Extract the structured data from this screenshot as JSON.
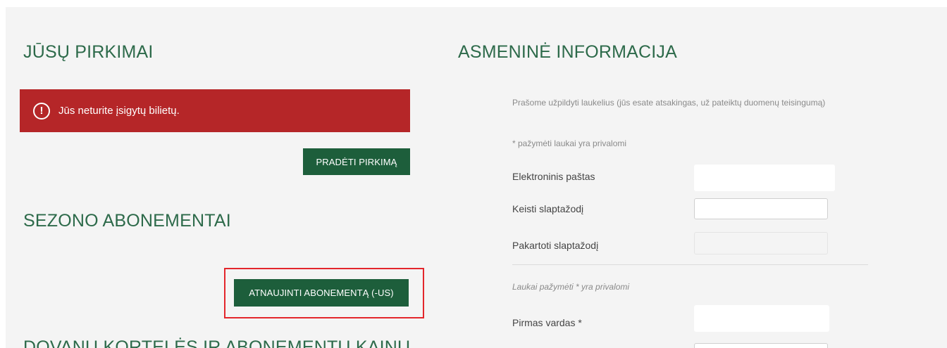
{
  "purchases": {
    "title": "JŪSŲ PIRKIMAI",
    "alert_text": "Jūs neturite įsigytų bilietų.",
    "alert_icon": "exclamation-circle-icon",
    "start_button": "PRADĖTI PIRKIMĄ"
  },
  "season": {
    "title": "SEZONO ABONEMENTAI",
    "renew_button": "ATNAUJINTI ABONEMENTĄ (-US)"
  },
  "gift": {
    "title": "DOVANŲ KORTELĖS IR ABONEMENTŲ KAINU"
  },
  "personal": {
    "title": "ASMENINĖ INFORMACIJA",
    "instructions": "Prašome užpildyti laukelius (jūs esate atsakingas, už pateiktų duomenų teisingumą)",
    "required_note_1": "* pažymėti laukai yra privalomi",
    "email_label": "Elektroninis paštas",
    "email_value": "",
    "password_label": "Keisti slaptažodį",
    "password_value": "",
    "password_repeat_label": "Pakartoti slaptažodį",
    "password_repeat_value": "",
    "required_note_2": "Laukai pažymėti * yra privalomi",
    "first_name_label": "Pirmas vardas *",
    "first_name_value": ""
  },
  "colors": {
    "brand_green": "#1d5e3b",
    "title_green": "#2d6a4a",
    "alert_red": "#b52628",
    "highlight_red": "#e3262b"
  }
}
